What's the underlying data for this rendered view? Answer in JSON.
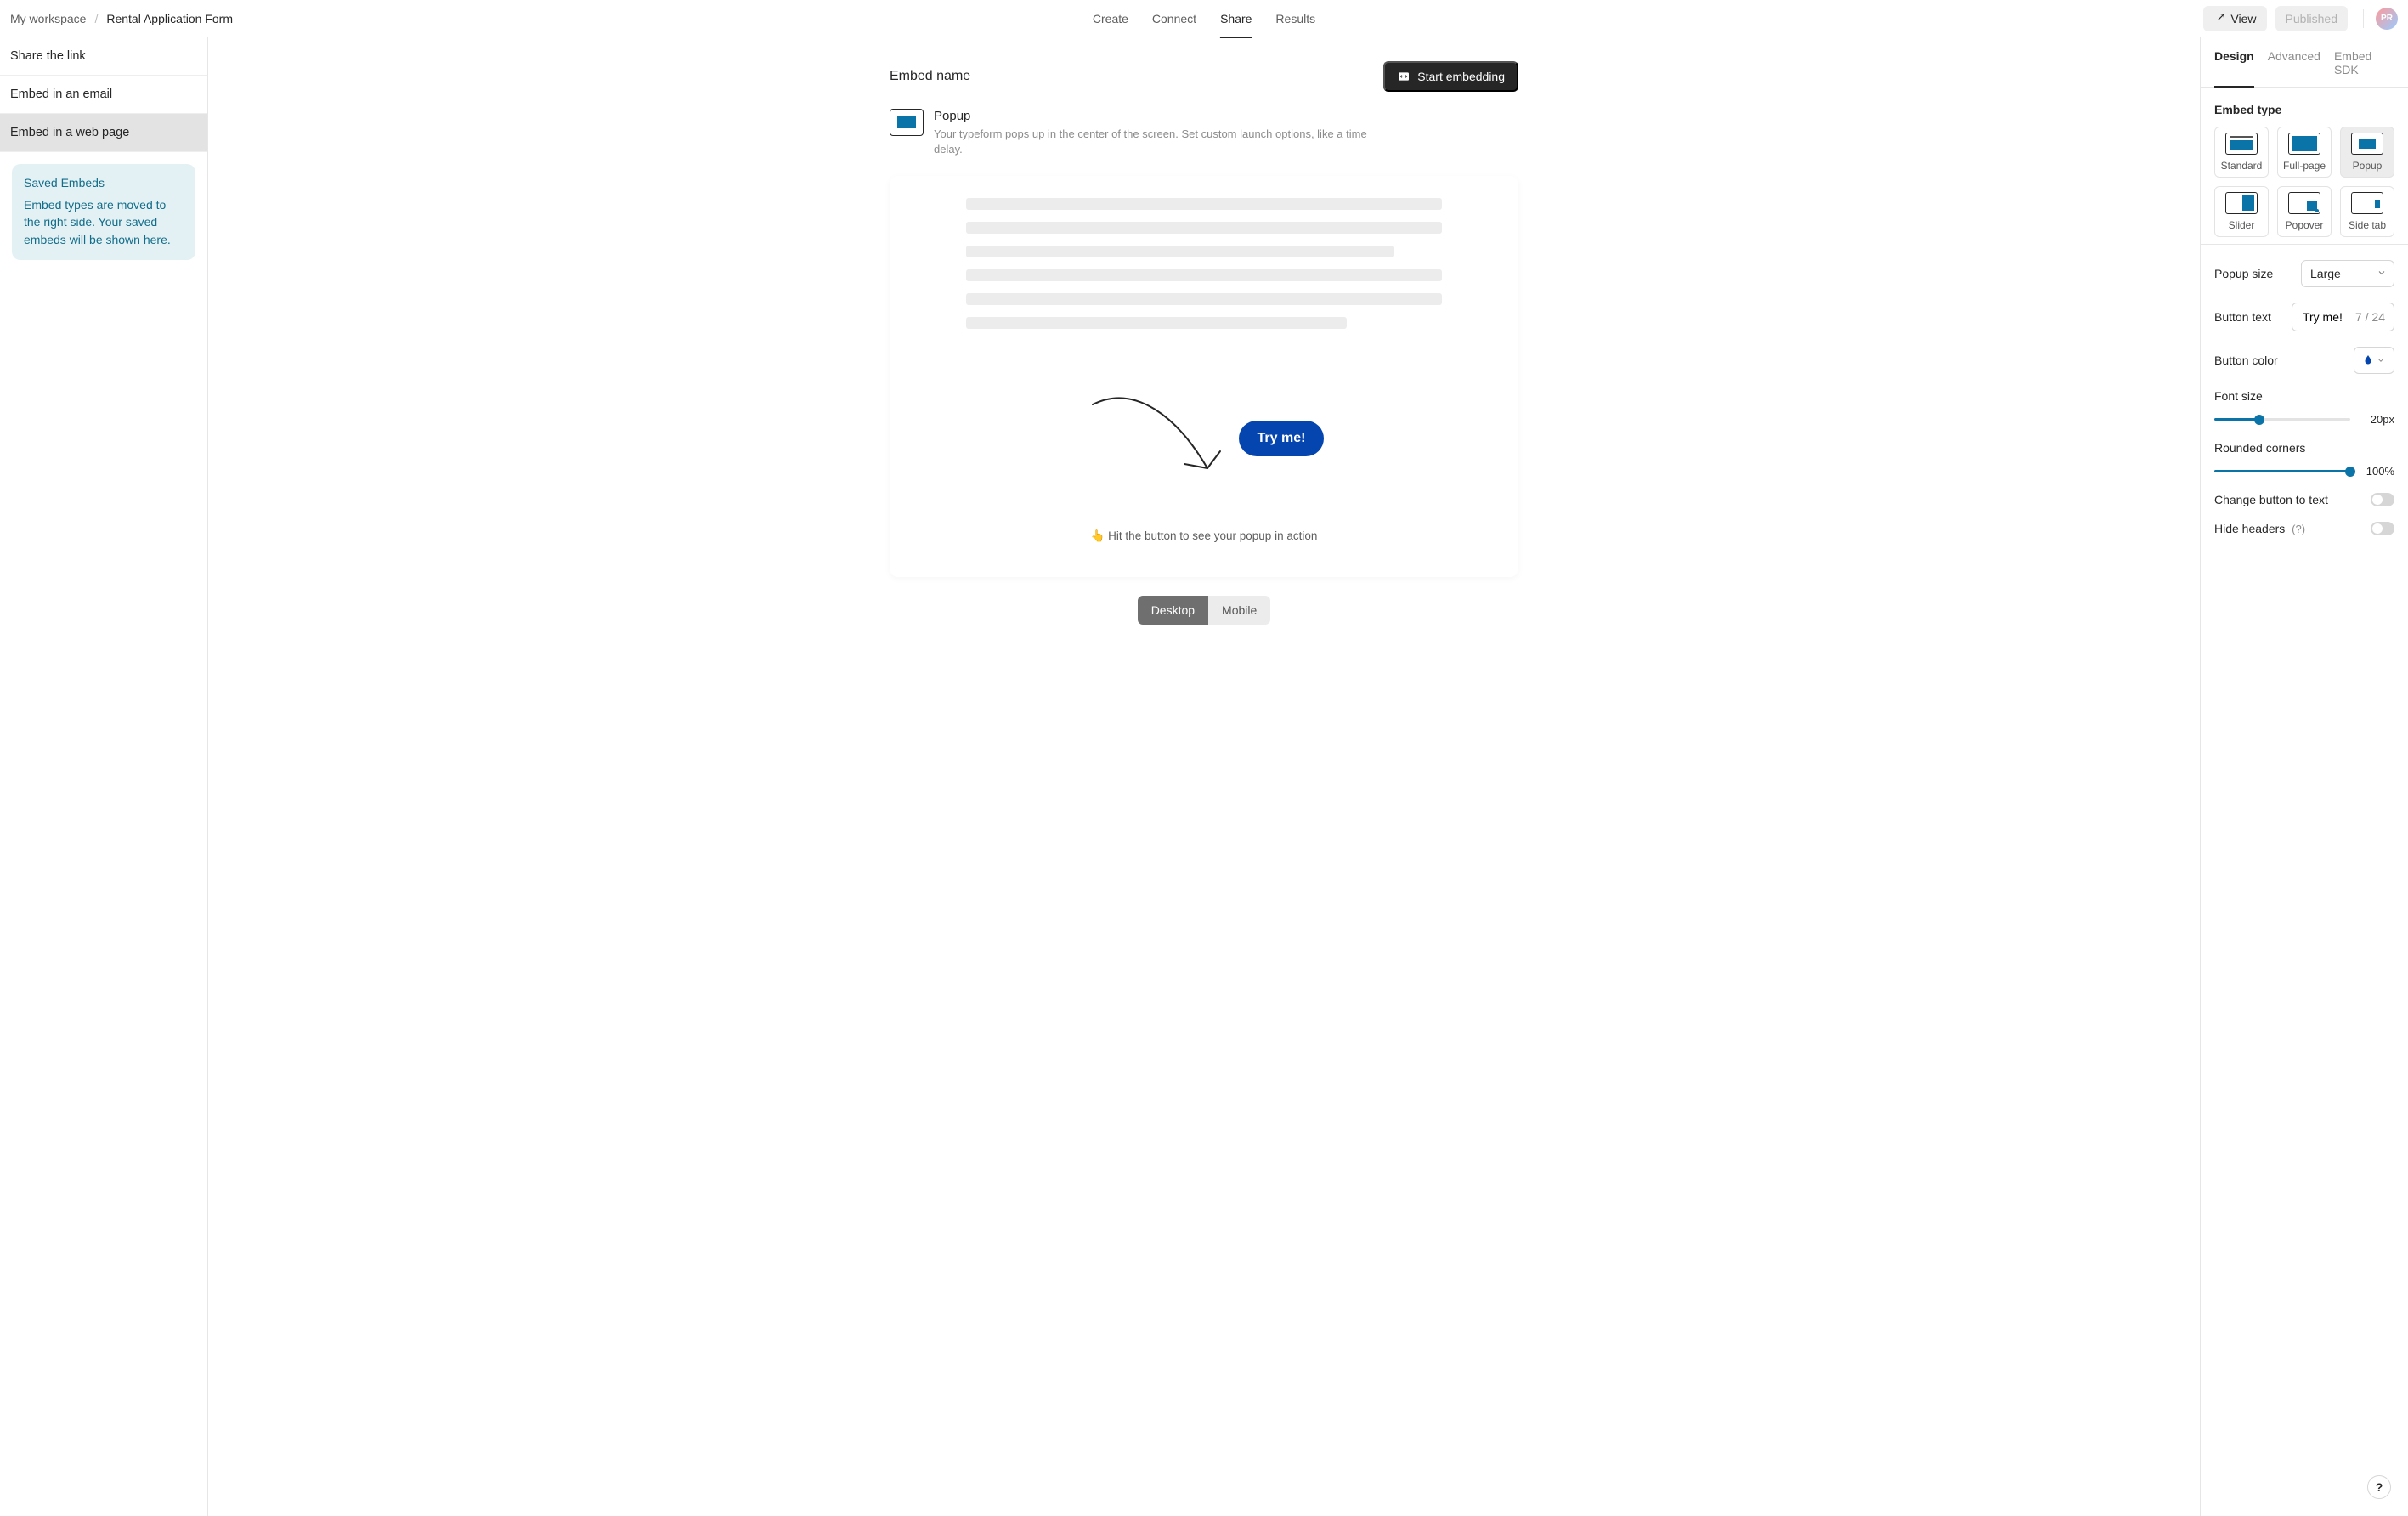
{
  "breadcrumb": {
    "workspace": "My workspace",
    "sep": "/",
    "form": "Rental Application Form"
  },
  "nav": {
    "create": "Create",
    "connect": "Connect",
    "share": "Share",
    "results": "Results"
  },
  "view_btn": "View",
  "published_btn": "Published",
  "avatar_initials": "PR",
  "left": {
    "share_link": "Share the link",
    "embed_email": "Embed in an email",
    "embed_web": "Embed in a web page",
    "saved_title": "Saved Embeds",
    "saved_body": "Embed types are moved to the right side. Your saved embeds will be shown here."
  },
  "center": {
    "embed_name_label": "Embed name",
    "start_embedding": "Start embedding",
    "type_title": "Popup",
    "type_desc": "Your typeform pops up in the center of the screen. Set custom launch options, like a time delay.",
    "try_btn": "Try me!",
    "hint": "👆 Hit the button to see your popup in action",
    "desktop": "Desktop",
    "mobile": "Mobile"
  },
  "right": {
    "tab_design": "Design",
    "tab_advanced": "Advanced",
    "tab_sdk": "Embed SDK",
    "embed_type_label": "Embed type",
    "types": {
      "standard": "Standard",
      "fullpage": "Full-page",
      "popup": "Popup",
      "slider": "Slider",
      "popover": "Popover",
      "sidetab": "Side tab"
    },
    "popup_size_label": "Popup size",
    "popup_size_value": "Large",
    "button_text_label": "Button text",
    "button_text_value": "Try me!",
    "button_text_counter": "7 / 24",
    "button_color_label": "Button color",
    "font_size_label": "Font size",
    "font_size_value": "20px",
    "font_size_pct": 33,
    "rounded_label": "Rounded corners",
    "rounded_value": "100%",
    "rounded_pct": 100,
    "change_to_text_label": "Change button to text",
    "hide_headers_label": "Hide headers",
    "help_q": "(?)"
  },
  "help_fab": "?"
}
